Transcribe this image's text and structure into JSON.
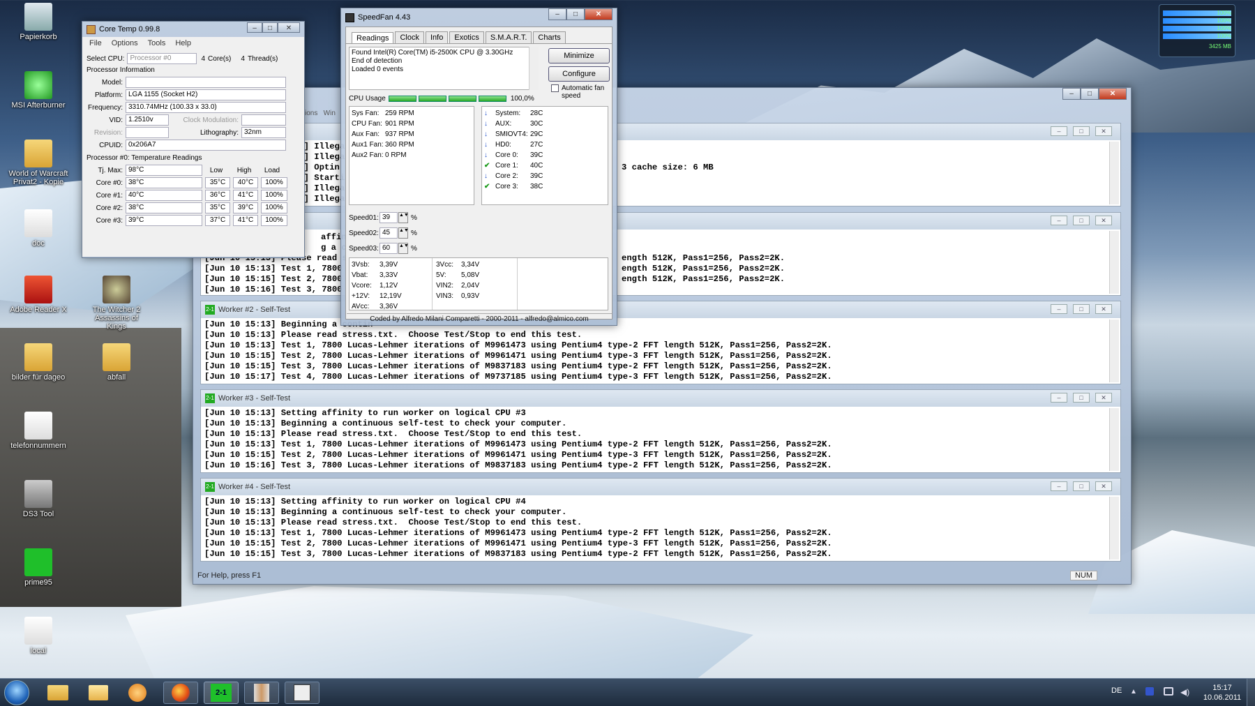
{
  "desktop": {
    "icons": [
      {
        "label": "Papierkorb",
        "icon": "recycle-bin-icon"
      },
      {
        "label": "MSI Afterburner",
        "icon": "msi-afterburner-icon"
      },
      {
        "label": "World of Warcraft\nPrivat2 - Kopie",
        "icon": "folder-icon"
      },
      {
        "label": "doc",
        "icon": "document-icon"
      },
      {
        "label": "Adobe Reader X",
        "icon": "pdf-icon"
      },
      {
        "label": "The Witcher 2\nAssassins of Kings",
        "icon": "witcher-icon"
      },
      {
        "label": "bilder für dageo",
        "icon": "folder-icon"
      },
      {
        "label": "abfall",
        "icon": "folder-icon"
      },
      {
        "label": "telefonnummern",
        "icon": "document-icon"
      },
      {
        "label": "DS3 Tool",
        "icon": "gamepad-icon"
      },
      {
        "label": "prime95",
        "icon": "prime95-icon"
      },
      {
        "label": "local",
        "icon": "document-icon"
      }
    ],
    "gadget": {
      "percents": [
        "100%",
        "100%",
        "100%",
        "100%"
      ],
      "memory": "3425 MB"
    }
  },
  "coretemp": {
    "title": "Core Temp 0.99.8",
    "menu": [
      "File",
      "Options",
      "Tools",
      "Help"
    ],
    "select_cpu_label": "Select CPU:",
    "select_cpu_value": "Processor #0",
    "cores_count": "4",
    "cores_label": "Core(s)",
    "threads_count": "4",
    "threads_label": "Thread(s)",
    "proc_info_label": "Processor Information",
    "model_label": "Model:",
    "model_value": "",
    "platform_label": "Platform:",
    "platform_value": "LGA 1155 (Socket H2)",
    "freq_label": "Frequency:",
    "freq_value": "3310.74MHz (100.33 x 33.0)",
    "vid_label": "VID:",
    "vid_value": "1.2510v",
    "clockmod_label": "Clock Modulation:",
    "clockmod_value": "",
    "revision_label": "Revision:",
    "revision_value": "",
    "litho_label": "Lithography:",
    "litho_value": "32nm",
    "cpuid_label": "CPUID:",
    "cpuid_value": "0x206A7",
    "temp_header": "Processor #0: Temperature Readings",
    "tjmax_label": "Tj. Max:",
    "tjmax_value": "98°C",
    "col_low": "Low",
    "col_high": "High",
    "col_load": "Load",
    "cores": [
      {
        "name": "Core #0:",
        "temp": "38°C",
        "low": "35°C",
        "high": "40°C",
        "load": "100%"
      },
      {
        "name": "Core #1:",
        "temp": "40°C",
        "low": "36°C",
        "high": "41°C",
        "load": "100%"
      },
      {
        "name": "Core #2:",
        "temp": "38°C",
        "low": "35°C",
        "high": "39°C",
        "load": "100%"
      },
      {
        "name": "Core #3:",
        "temp": "39°C",
        "low": "37°C",
        "high": "41°C",
        "load": "100%"
      }
    ]
  },
  "speedfan": {
    "title": "SpeedFan 4.43",
    "tabs": [
      "Readings",
      "Clock",
      "Info",
      "Exotics",
      "S.M.A.R.T.",
      "Charts"
    ],
    "log": [
      "Found Intel(R) Core(TM) i5-2500K CPU @ 3.30GHz",
      "End of detection",
      "Loaded 0 events"
    ],
    "minimize": "Minimize",
    "configure": "Configure",
    "auto_fan": "Automatic fan speed",
    "cpu_usage_label": "CPU Usage",
    "cpu_usage_value": "100,0%",
    "fans": [
      [
        "Sys Fan:",
        "259 RPM"
      ],
      [
        "CPU Fan:",
        "901 RPM"
      ],
      [
        "Aux Fan:",
        "937 RPM"
      ],
      [
        "Aux1 Fan:",
        "360 RPM"
      ],
      [
        "Aux2 Fan:",
        "0 RPM"
      ]
    ],
    "temps": [
      {
        "name": "System:",
        "value": "28C",
        "icon": "arrow-down-icon"
      },
      {
        "name": "AUX:",
        "value": "30C",
        "icon": "arrow-down-icon"
      },
      {
        "name": "SMIOVT4:",
        "value": "29C",
        "icon": "arrow-down-icon"
      },
      {
        "name": "HD0:",
        "value": "27C",
        "icon": "arrow-down-icon"
      },
      {
        "name": "Core 0:",
        "value": "39C",
        "icon": "arrow-down-icon"
      },
      {
        "name": "Core 1:",
        "value": "40C",
        "icon": "check-icon"
      },
      {
        "name": "Core 2:",
        "value": "39C",
        "icon": "arrow-down-icon"
      },
      {
        "name": "Core 3:",
        "value": "38C",
        "icon": "check-icon"
      }
    ],
    "speeds": [
      [
        "Speed01:",
        "39",
        "%"
      ],
      [
        "Speed02:",
        "45",
        "%"
      ],
      [
        "Speed03:",
        "60",
        "%"
      ]
    ],
    "volts_left": [
      [
        "3Vsb:",
        "3,39V"
      ],
      [
        "Vbat:",
        "3,33V"
      ],
      [
        "Vcore:",
        "1,12V"
      ],
      [
        "+12V:",
        "12,19V"
      ],
      [
        "AVcc:",
        "3,36V"
      ]
    ],
    "volts_right": [
      [
        "3Vcc:",
        "3,34V"
      ],
      [
        "5V:",
        "5,08V"
      ],
      [
        "VIN2:",
        "2,04V"
      ],
      [
        "VIN3:",
        "0,93V"
      ]
    ],
    "footer": "Coded by Alfredo Milani Comparetti - 2000-2011 - alfredo@almico.com"
  },
  "prime95": {
    "menu_fragment": "ions   Win",
    "worker1_partial": [
      "13] Illega",
      "13] Illega",
      "13] Optin",
      "13] Startin",
      "13] Illega",
      "13] Illega"
    ],
    "worker1_right": "3 cache size: 6 MB",
    "worker_top_lines": [
      "affinity to",
      "g a contin",
      "[Jun 10 15:13] Please read stres",
      "[Jun 10 15:13] Test 1, 7800 Luca",
      "[Jun 10 15:15] Test 2, 7800 Luca",
      "[Jun 10 15:16] Test 3, 7800 Luca"
    ],
    "worker_top_right": [
      "ength 512K, Pass1=256, Pass2=2K.",
      "ength 512K, Pass1=256, Pass2=2K.",
      "ength 512K, Pass1=256, Pass2=2K."
    ],
    "workers": [
      {
        "title": "Worker #2 - Self-Test",
        "lines": [
          "[Jun 10 15:13] Beginning a contin",
          "[Jun 10 15:13] Please read stress.txt.  Choose Test/Stop to end this test.",
          "[Jun 10 15:13] Test 1, 7800 Lucas-Lehmer iterations of M9961473 using Pentium4 type-2 FFT length 512K, Pass1=256, Pass2=2K.",
          "[Jun 10 15:15] Test 2, 7800 Lucas-Lehmer iterations of M9961471 using Pentium4 type-3 FFT length 512K, Pass1=256, Pass2=2K.",
          "[Jun 10 15:15] Test 3, 7800 Lucas-Lehmer iterations of M9837183 using Pentium4 type-2 FFT length 512K, Pass1=256, Pass2=2K.",
          "[Jun 10 15:17] Test 4, 7800 Lucas-Lehmer iterations of M9737185 using Pentium4 type-3 FFT length 512K, Pass1=256, Pass2=2K."
        ]
      },
      {
        "title": "Worker #3 - Self-Test",
        "lines": [
          "[Jun 10 15:13] Setting affinity to run worker on logical CPU #3",
          "[Jun 10 15:13] Beginning a continuous self-test to check your computer.",
          "[Jun 10 15:13] Please read stress.txt.  Choose Test/Stop to end this test.",
          "[Jun 10 15:13] Test 1, 7800 Lucas-Lehmer iterations of M9961473 using Pentium4 type-2 FFT length 512K, Pass1=256, Pass2=2K.",
          "[Jun 10 15:15] Test 2, 7800 Lucas-Lehmer iterations of M9961471 using Pentium4 type-3 FFT length 512K, Pass1=256, Pass2=2K.",
          "[Jun 10 15:16] Test 3, 7800 Lucas-Lehmer iterations of M9837183 using Pentium4 type-2 FFT length 512K, Pass1=256, Pass2=2K."
        ]
      },
      {
        "title": "Worker #4 - Self-Test",
        "lines": [
          "[Jun 10 15:13] Setting affinity to run worker on logical CPU #4",
          "[Jun 10 15:13] Beginning a continuous self-test to check your computer.",
          "[Jun 10 15:13] Please read stress.txt.  Choose Test/Stop to end this test.",
          "[Jun 10 15:13] Test 1, 7800 Lucas-Lehmer iterations of M9961473 using Pentium4 type-2 FFT length 512K, Pass1=256, Pass2=2K.",
          "[Jun 10 15:15] Test 2, 7800 Lucas-Lehmer iterations of M9961471 using Pentium4 type-3 FFT length 512K, Pass1=256, Pass2=2K.",
          "[Jun 10 15:15] Test 3, 7800 Lucas-Lehmer iterations of M9837183 using Pentium4 type-2 FFT length 512K, Pass1=256, Pass2=2K."
        ]
      }
    ],
    "status_help": "For Help, press F1",
    "status_num": "NUM"
  },
  "taskbar": {
    "lang": "DE",
    "time": "15:17",
    "date": "10.06.2011"
  }
}
